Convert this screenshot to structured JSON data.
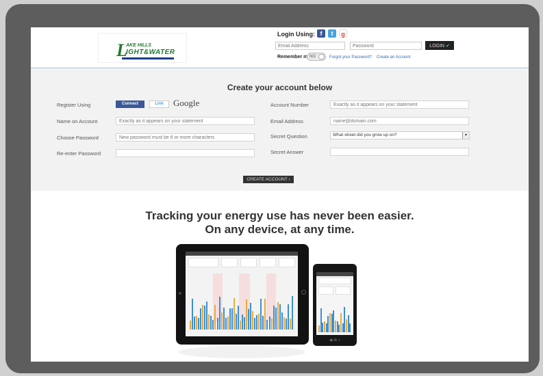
{
  "header": {
    "login_label": "Login Using:",
    "email_placeholder": "Email Address",
    "password_placeholder": "Password",
    "login_button": "LOGIN",
    "remember_label": "Remember me",
    "toggle_value": "NO",
    "forgot_link": "Forgot your Password?",
    "create_link": "Create an Account"
  },
  "logo": {
    "letter": "L",
    "line1": "AKE HILLS",
    "line2": "IGHT&WATER"
  },
  "form": {
    "title": "Create your account below",
    "register_using_label": "Register Using",
    "fb_connect": "Connect",
    "twitter_link": "Link",
    "google_label": "Google",
    "name_label": "Name on Account",
    "name_placeholder": "Exactly as it appears on your statement",
    "password_label": "Choose Password",
    "password_placeholder": "New password must be 6 or more characters",
    "reenter_label": "Re-enter Password",
    "account_number_label": "Account Number",
    "account_number_placeholder": "Exactly as it appears on your statement",
    "email_label": "Email Address",
    "email_placeholder": "name@domain.com",
    "secret_question_label": "Secret Question",
    "secret_question_value": "What street did you grow up on?",
    "secret_answer_label": "Secret Answer",
    "create_button": "CREATE ACCOUNT"
  },
  "promo": {
    "line1": "Tracking your energy use has never been easier.",
    "line2": "On any device, at any time."
  },
  "colors": {
    "frame": "#5d5d5d",
    "form_bg": "#f2f2f2",
    "logo_green": "#1f7a2e",
    "chart_blue": "#3d8fd1",
    "chart_gold": "#e9a93c"
  }
}
